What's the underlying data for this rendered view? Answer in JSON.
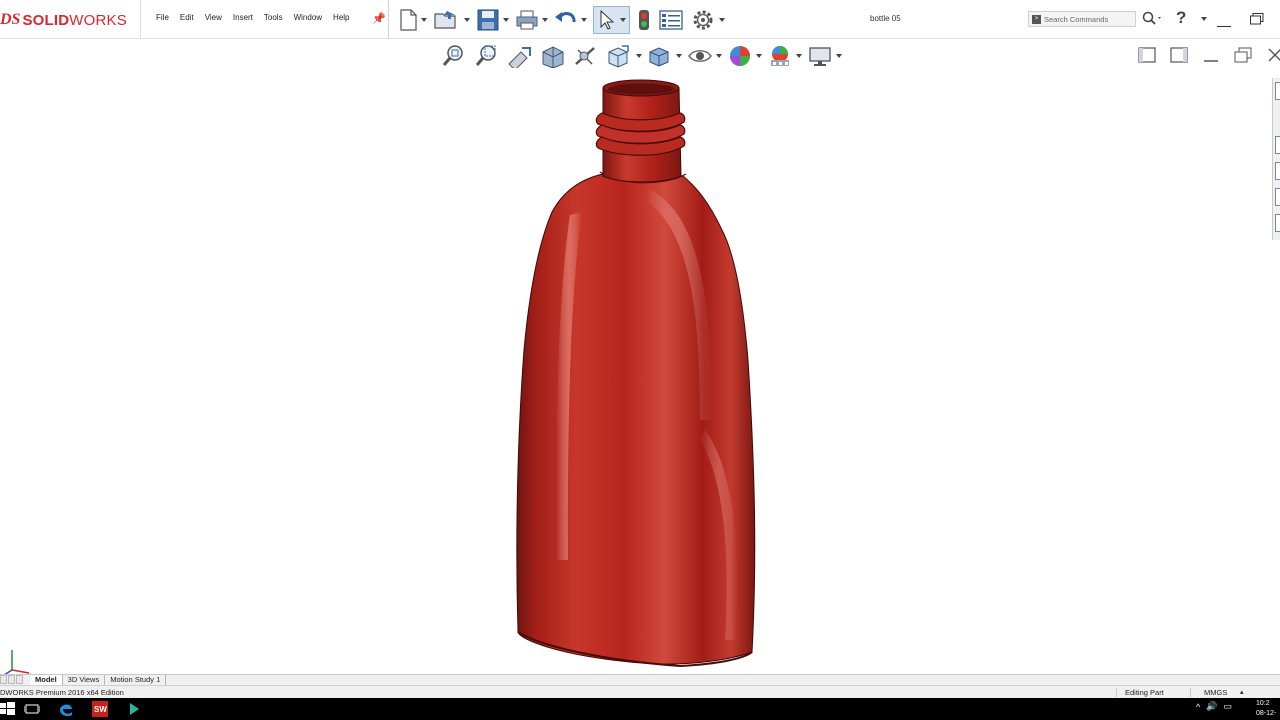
{
  "app": {
    "logo_ds": "DS",
    "logo_brand_a": "SOLID",
    "logo_brand_b": "WORKS",
    "document_title": "bottle 05",
    "brand_color": "#d9282f"
  },
  "menu": {
    "items": [
      "File",
      "Edit",
      "View",
      "Insert",
      "Tools",
      "Window",
      "Help"
    ]
  },
  "toolbar": {
    "icons": [
      "new-document-icon",
      "open-folder-icon",
      "save-icon",
      "print-icon",
      "undo-icon",
      "select-arrow-icon",
      "rebuild-traffic-light-icon",
      "file-properties-icon",
      "options-gear-icon"
    ]
  },
  "search": {
    "placeholder": "Search Commands"
  },
  "view_toolbar": {
    "icons": [
      "zoom-to-fit-icon",
      "zoom-to-area-icon",
      "previous-view-icon",
      "section-view-icon",
      "dynamic-annotation-icon",
      "view-orientation-icon",
      "display-style-icon",
      "hide-show-items-icon",
      "edit-appearance-icon",
      "apply-scene-icon",
      "view-settings-icon"
    ]
  },
  "model": {
    "part_color": "#b8241c",
    "part_name": "bottle"
  },
  "tabs": {
    "items": [
      "Model",
      "3D Views",
      "Motion Study 1"
    ],
    "active": "Model"
  },
  "status": {
    "edition": "DWORKS Premium 2016 x64 Edition",
    "mode": "Editing Part",
    "units": "MMGS",
    "units_caret": "▴"
  },
  "taskbar": {
    "clock_time": "10:2",
    "clock_date": "08-12-"
  }
}
